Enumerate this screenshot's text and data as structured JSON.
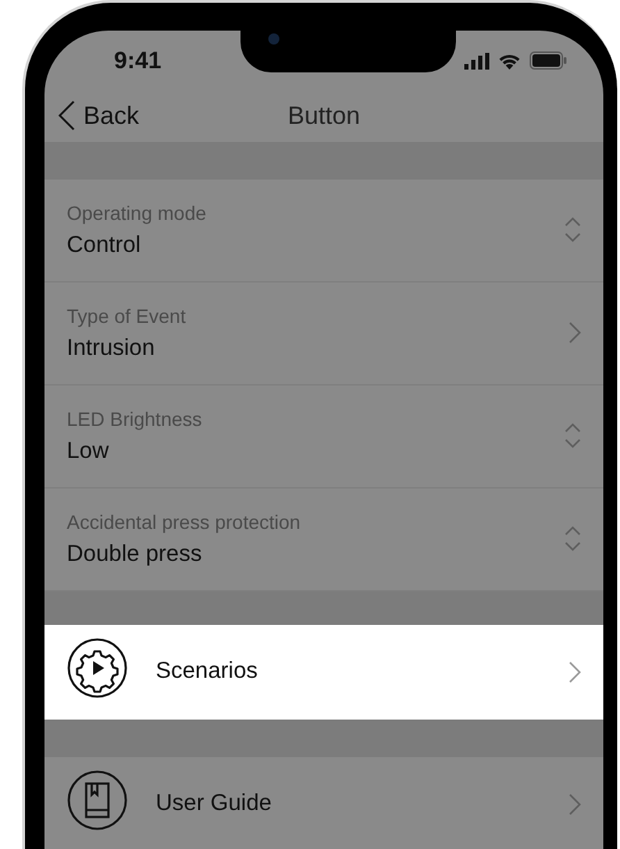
{
  "status_bar": {
    "time": "9:41"
  },
  "nav": {
    "back": "Back",
    "title": "Button"
  },
  "settings": [
    {
      "kind": "picker",
      "label": "Operating mode",
      "value": "Control"
    },
    {
      "kind": "link",
      "label": "Type of Event",
      "value": "Intrusion"
    },
    {
      "kind": "picker",
      "label": "LED Brightness",
      "value": "Low"
    },
    {
      "kind": "picker",
      "label": "Accidental press protection",
      "value": "Double press"
    }
  ],
  "menu": [
    {
      "kind": "scenarios",
      "label": "Scenarios",
      "highlighted": true
    },
    {
      "kind": "guide",
      "label": "User Guide",
      "highlighted": false
    }
  ]
}
